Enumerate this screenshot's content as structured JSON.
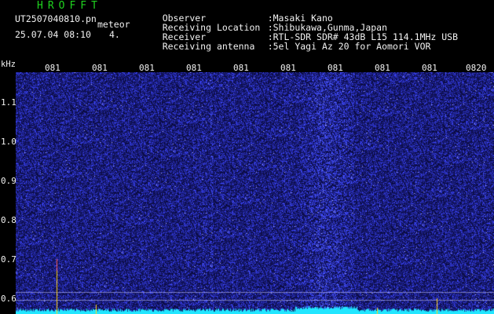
{
  "header": {
    "logo": "HROFFT",
    "filename": "UT2507040810.pn",
    "meteor_label": "meteor",
    "datetime": "25.07.04 08:10",
    "count": "4.",
    "info": [
      {
        "label": "Observer",
        "value": ":Masaki Kano"
      },
      {
        "label": "Receiving Location",
        "value": ":Shibukawa,Gunma,Japan"
      },
      {
        "label": "Receiver",
        "value": ":RTL-SDR SDR# 43dB L15 114.1MHz USB"
      },
      {
        "label": "Receiving antenna",
        "value": ":5el Yagi Az 20 for Aomori VOR"
      }
    ]
  },
  "axis": {
    "freq_unit": "kHz",
    "time_labels": [
      "081",
      "081",
      "081",
      "081",
      "081",
      "081",
      "081",
      "081",
      "081",
      "0820"
    ],
    "freq_ticks": [
      "1.1",
      "1.0",
      "0.9",
      "0.8",
      "0.7",
      "0.6"
    ]
  },
  "colors": {
    "background": "#000000",
    "noise_blue": "#2a2ad8",
    "trace_cyan": "#22e6ff",
    "marker_yellow": "#ffd21a",
    "logo_green": "#1fd41f"
  }
}
